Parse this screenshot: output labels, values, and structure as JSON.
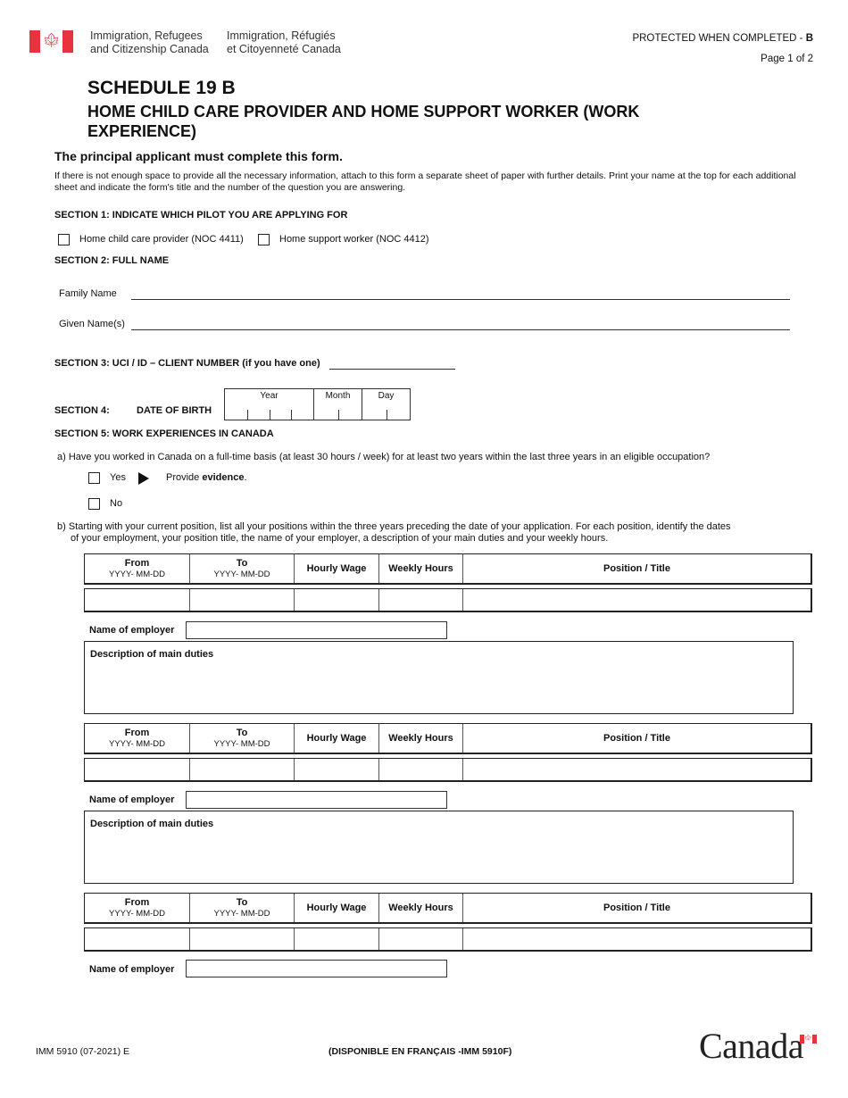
{
  "header": {
    "department_en_line1": "Immigration, Refugees",
    "department_en_line2": "and Citizenship Canada",
    "department_fr_line1": "Immigration, Réfugiés",
    "department_fr_line2": "et Citoyenneté Canada",
    "flag_icon": "canada-flag-icon",
    "protected_label": "PROTECTED WHEN COMPLETED - ",
    "protected_level": "B",
    "page_indicator": "Page 1 of 2"
  },
  "title": {
    "schedule": "SCHEDULE 19 B",
    "subtitle": "HOME CHILD CARE PROVIDER AND HOME SUPPORT WORKER (WORK EXPERIENCE)"
  },
  "lead": "The principal applicant must complete this form.",
  "intro": "If there is not enough space to provide all the necessary information, attach to this form a separate sheet of paper with further details. Print your name at the top for each additional sheet and indicate the form's title and the number of the question you are answering.",
  "section1": {
    "heading": "SECTION 1: INDICATE WHICH PILOT YOU ARE APPLYING FOR",
    "options": [
      {
        "label": "Home child care provider (NOC 4411)",
        "checked": false
      },
      {
        "label": "Home support worker (NOC 4412)",
        "checked": false
      }
    ]
  },
  "section2": {
    "heading": "SECTION 2: FULL NAME",
    "family_name_label": "Family Name",
    "family_name_value": "",
    "given_names_label": "Given Name(s)",
    "given_names_value": ""
  },
  "section3": {
    "heading": "SECTION 3: UCI / ID – CLIENT NUMBER (if you have one)",
    "value": ""
  },
  "section4": {
    "heading": "SECTION 4:",
    "label": "DATE  OF BIRTH",
    "year_label": "Year",
    "month_label": "Month",
    "day_label": "Day",
    "year": "",
    "month": "",
    "day": ""
  },
  "section5": {
    "heading": "SECTION 5: WORK EXPERIENCES IN CANADA",
    "question_a": "a)  Have you worked in Canada on a full-time basis (at least 30 hours / week) for at least two years within the last three years in an eligible occupation?",
    "yes_label": "Yes",
    "yes_checked": false,
    "provide_prefix": "Provide ",
    "provide_bold": "evidence",
    "provide_suffix": ".",
    "no_label": "No",
    "no_checked": false,
    "question_b_line1": "b)  Starting with your current position, list all your positions within the three years preceding the date of your application. For each position, identify the dates",
    "question_b_line2": "of your employment, your position title, the name of your employer, a description of your main duties and your weekly hours.",
    "table_headers": {
      "from": "From",
      "from_format": "YYYY- MM-DD",
      "to": "To",
      "to_format": "YYYY- MM-DD",
      "hourly_wage": "Hourly Wage",
      "weekly_hours": "Weekly Hours",
      "position_title": "Position / Title"
    },
    "employer_label": "Name of employer",
    "duties_label": "Description of main duties",
    "positions": [
      {
        "from": "",
        "to": "",
        "hourly_wage": "",
        "weekly_hours": "",
        "position_title": "",
        "employer": "",
        "duties": ""
      },
      {
        "from": "",
        "to": "",
        "hourly_wage": "",
        "weekly_hours": "",
        "position_title": "",
        "employer": "",
        "duties": ""
      },
      {
        "from": "",
        "to": "",
        "hourly_wage": "",
        "weekly_hours": "",
        "position_title": "",
        "employer": ""
      }
    ]
  },
  "footer": {
    "form_code": "IMM 5910 (07-2021) E",
    "french_note": "(DISPONIBLE EN FRANÇAIS -IMM 5910F)",
    "wordmark": "Canada",
    "wordmark_icon": "canada-wordmark-flag-icon"
  },
  "colors": {
    "flag_red": "#e8333f"
  }
}
